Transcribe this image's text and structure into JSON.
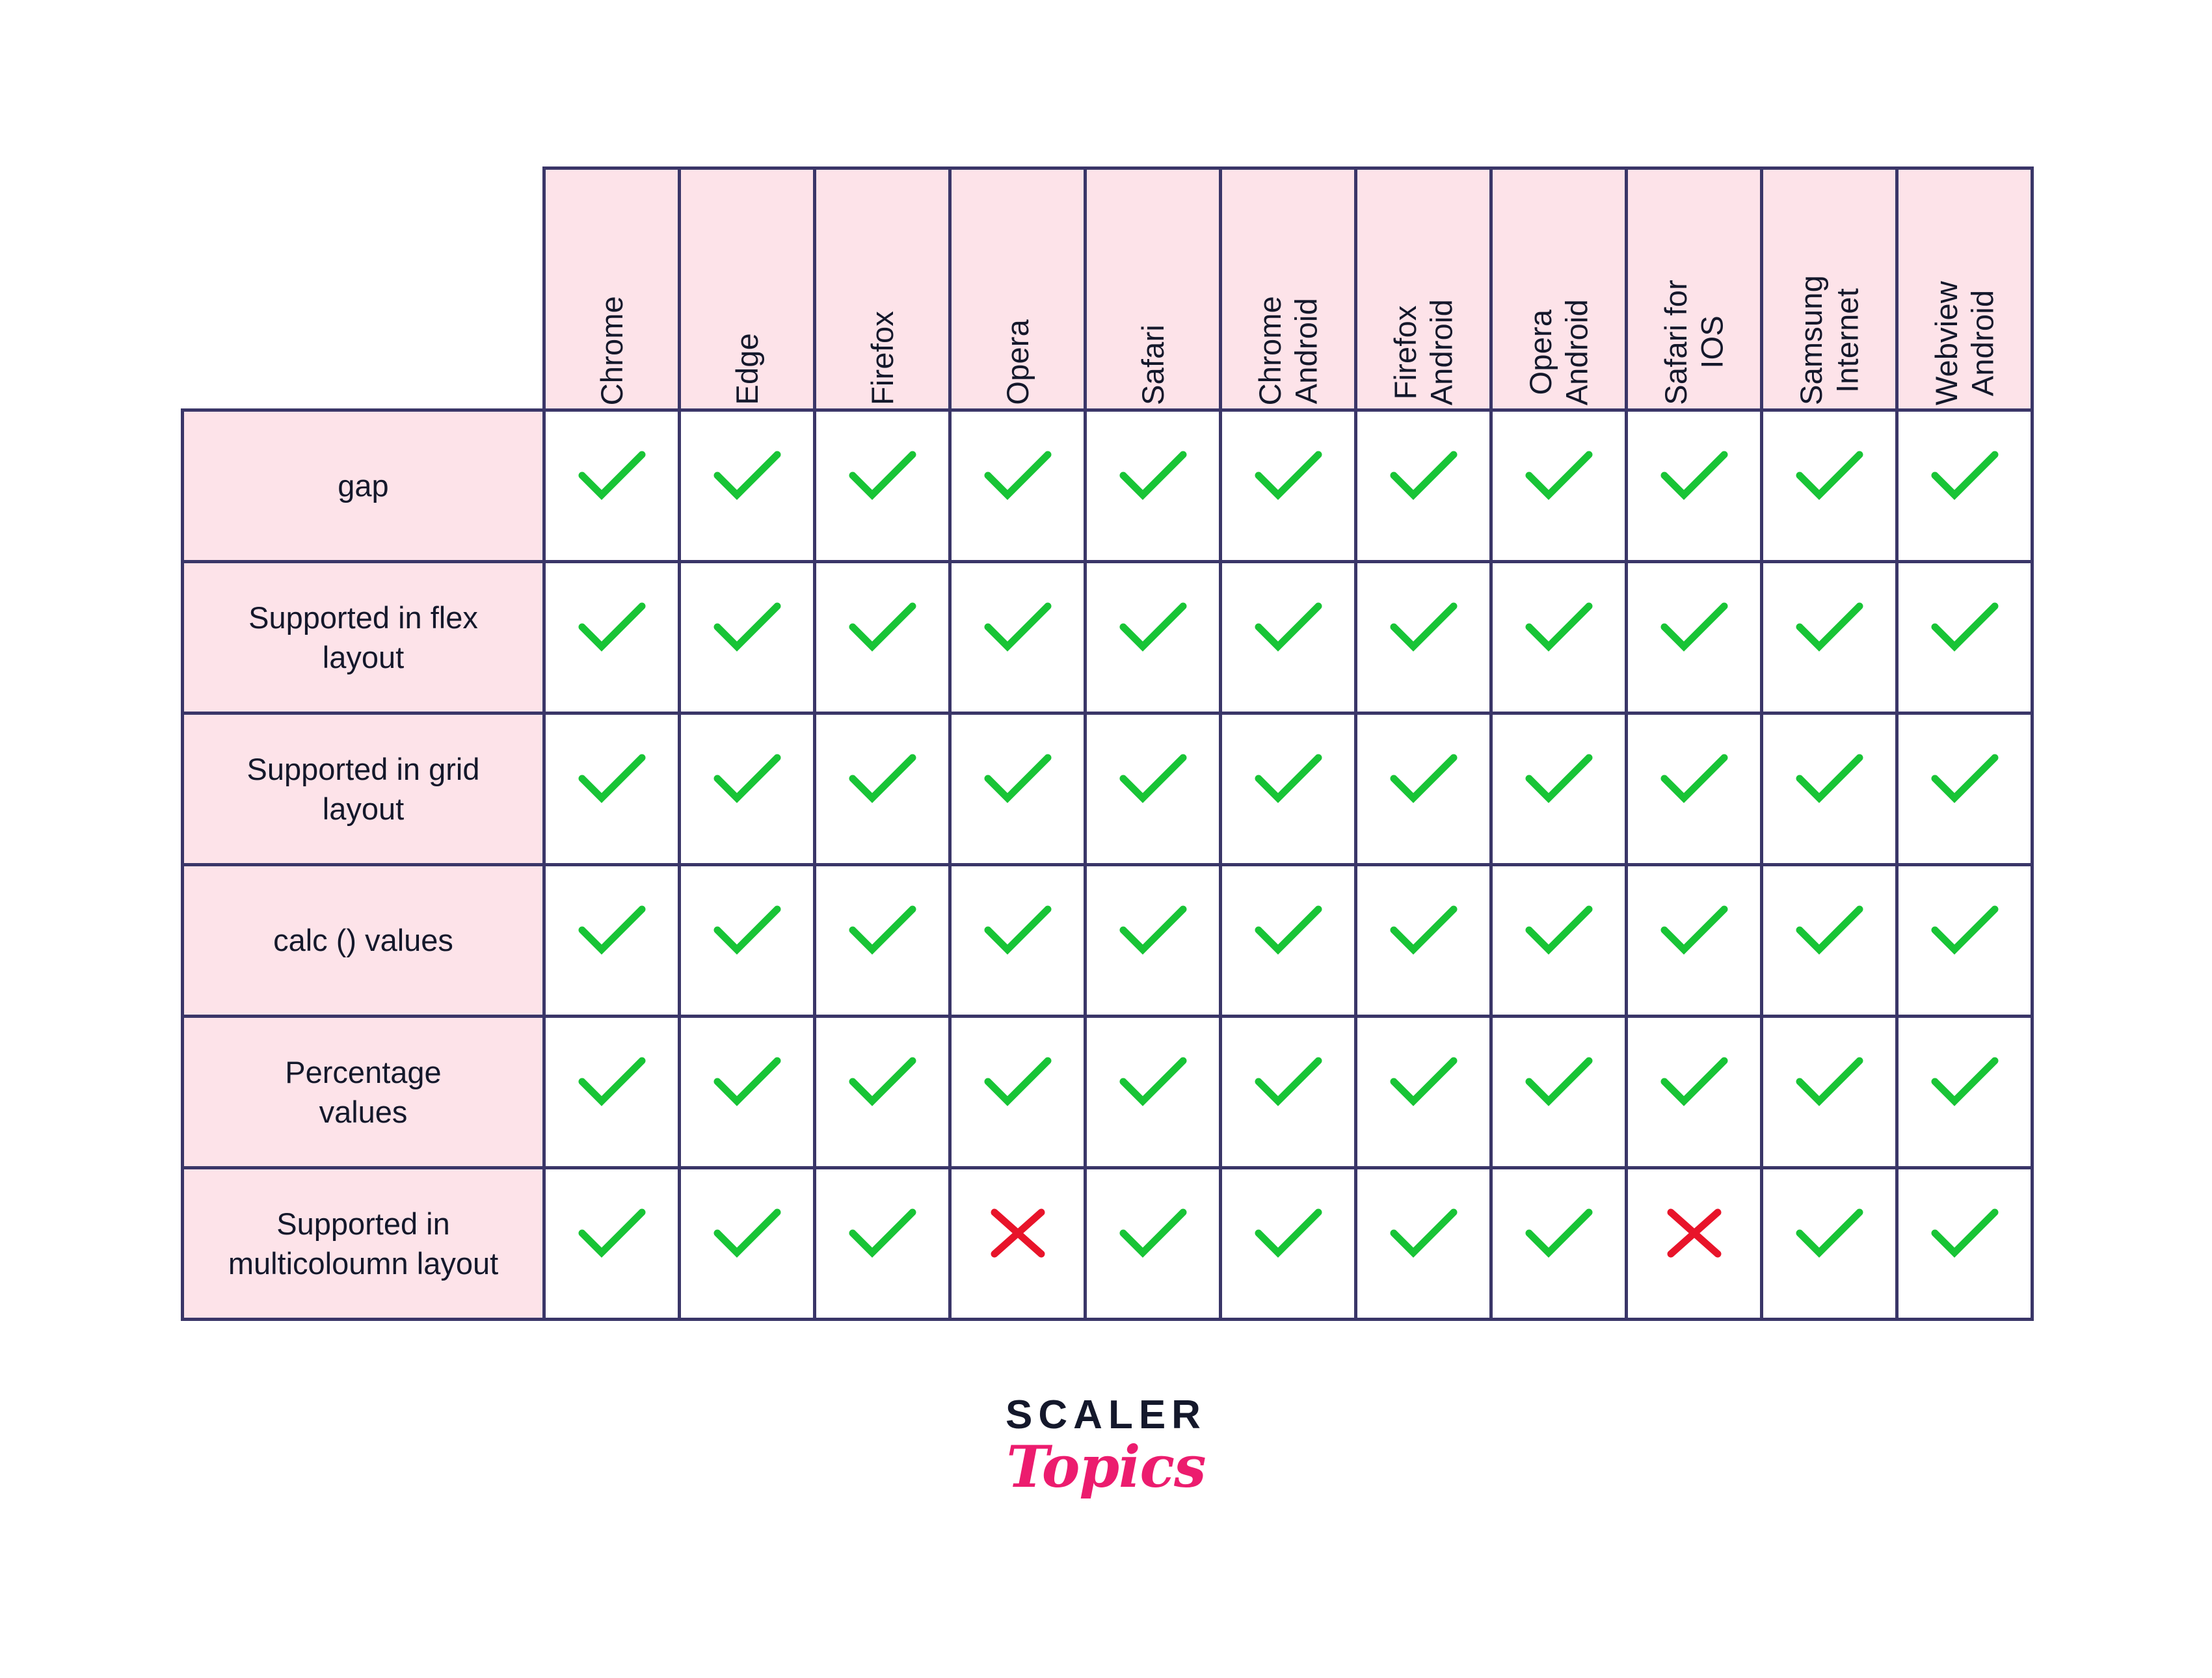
{
  "table": {
    "corner_label": "",
    "columns": [
      {
        "name": "chrome",
        "label": "Chrome"
      },
      {
        "name": "edge",
        "label": "Edge"
      },
      {
        "name": "firefox",
        "label": "Firefox"
      },
      {
        "name": "opera",
        "label": "Opera"
      },
      {
        "name": "safari",
        "label": "Safari"
      },
      {
        "name": "chrome-android",
        "label": "Chrome\nAndroid"
      },
      {
        "name": "firefox-android",
        "label": "Firefox\nAndroid"
      },
      {
        "name": "opera-android",
        "label": "Opera\nAndroid"
      },
      {
        "name": "safari-ios",
        "label": "Safari for\nIOS"
      },
      {
        "name": "samsung-internet",
        "label": "Samsung\nInternet"
      },
      {
        "name": "webview-android",
        "label": "Webview\nAndroid"
      }
    ],
    "rows": [
      {
        "name": "gap",
        "label": "gap",
        "support": [
          "yes",
          "yes",
          "yes",
          "yes",
          "yes",
          "yes",
          "yes",
          "yes",
          "yes",
          "yes",
          "yes"
        ]
      },
      {
        "name": "supported-in-flex-layout",
        "label": "Supported in flex\nlayout",
        "support": [
          "yes",
          "yes",
          "yes",
          "yes",
          "yes",
          "yes",
          "yes",
          "yes",
          "yes",
          "yes",
          "yes"
        ]
      },
      {
        "name": "supported-in-grid-layout",
        "label": "Supported in grid\nlayout",
        "support": [
          "yes",
          "yes",
          "yes",
          "yes",
          "yes",
          "yes",
          "yes",
          "yes",
          "yes",
          "yes",
          "yes"
        ]
      },
      {
        "name": "calc-values",
        "label": "calc () values",
        "support": [
          "yes",
          "yes",
          "yes",
          "yes",
          "yes",
          "yes",
          "yes",
          "yes",
          "yes",
          "yes",
          "yes"
        ]
      },
      {
        "name": "percentage-values",
        "label": "Percentage\nvalues",
        "support": [
          "yes",
          "yes",
          "yes",
          "yes",
          "yes",
          "yes",
          "yes",
          "yes",
          "yes",
          "yes",
          "yes"
        ]
      },
      {
        "name": "supported-in-multicolumn-layout",
        "label": "Supported in\nmulticoloumn layout",
        "support": [
          "yes",
          "yes",
          "yes",
          "no",
          "yes",
          "yes",
          "yes",
          "yes",
          "no",
          "yes",
          "yes"
        ]
      }
    ],
    "icons": {
      "yes": "check-icon",
      "no": "cross-icon"
    }
  },
  "logo": {
    "primary": "SCALER",
    "secondary": "Topics"
  },
  "colors": {
    "header_background": "#fde3e9",
    "row_label_background": "#fde3e9",
    "border": "#3a3668",
    "text": "#14182b",
    "check": "#18c436",
    "cross": "#e8142a",
    "logo_primary": "#14182b",
    "logo_secondary": "#ec1c6e",
    "page_background": "#ffffff"
  }
}
